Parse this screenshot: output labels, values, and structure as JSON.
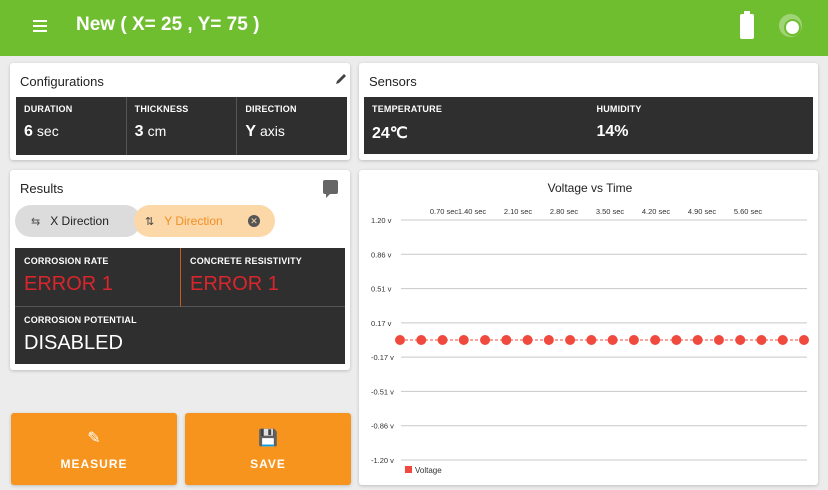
{
  "header": {
    "title": "New ( X= 25 , Y= 75 )",
    "bar_color": "#6fbe2f"
  },
  "configurations": {
    "title": "Configurations",
    "stats": [
      {
        "label": "DURATION",
        "value": "6",
        "unit": "sec"
      },
      {
        "label": "THICKNESS",
        "value": "3",
        "unit": "cm"
      },
      {
        "label": "DIRECTION",
        "value": "Y",
        "unit": "axis"
      }
    ]
  },
  "sensors": {
    "title": "Sensors",
    "stats": [
      {
        "label": "TEMPERATURE",
        "value": "24℃"
      },
      {
        "label": "HUMIDITY",
        "value": "14%"
      }
    ]
  },
  "results": {
    "title": "Results",
    "chips": [
      {
        "label": "X Direction",
        "icon": "swap-horizontal-icon",
        "selected": false
      },
      {
        "label": "Y Direction",
        "icon": "swap-vertical-icon",
        "selected": true
      }
    ],
    "corrosion_rate": {
      "label": "CORROSION RATE",
      "value": "ERROR 1"
    },
    "concrete_resistivity": {
      "label": "CONCRETE RESISTIVITY",
      "value": "ERROR 1"
    },
    "corrosion_potential": {
      "label": "CORROSION POTENTIAL",
      "value": "DISABLED"
    }
  },
  "actions": {
    "measure_label": "MEASURE",
    "save_label": "SAVE",
    "accent": "#f7941d"
  },
  "chart_data": {
    "type": "line",
    "title": "Voltage vs Time",
    "xlabel": "",
    "ylabel": "",
    "x_tick_labels": [
      "0.70 sec",
      "1.40 sec",
      "2.10 sec",
      "2.80 sec",
      "3.50 sec",
      "4.20 sec",
      "4.90 sec",
      "5.60 sec"
    ],
    "y_tick_labels": [
      "1.20 v",
      "0.86 v",
      "0.51 v",
      "0.17 v",
      "-0.17 v",
      "-0.51 v",
      "-0.86 v",
      "-1.20 v"
    ],
    "ylim": [
      -1.2,
      1.2
    ],
    "grid": true,
    "legend": "bottom-left",
    "series": [
      {
        "name": "Voltage",
        "color": "#f04a3e",
        "values": [
          0,
          0,
          0,
          0,
          0,
          0,
          0,
          0,
          0,
          0,
          0,
          0,
          0,
          0,
          0,
          0,
          0,
          0,
          0,
          0
        ]
      }
    ]
  }
}
